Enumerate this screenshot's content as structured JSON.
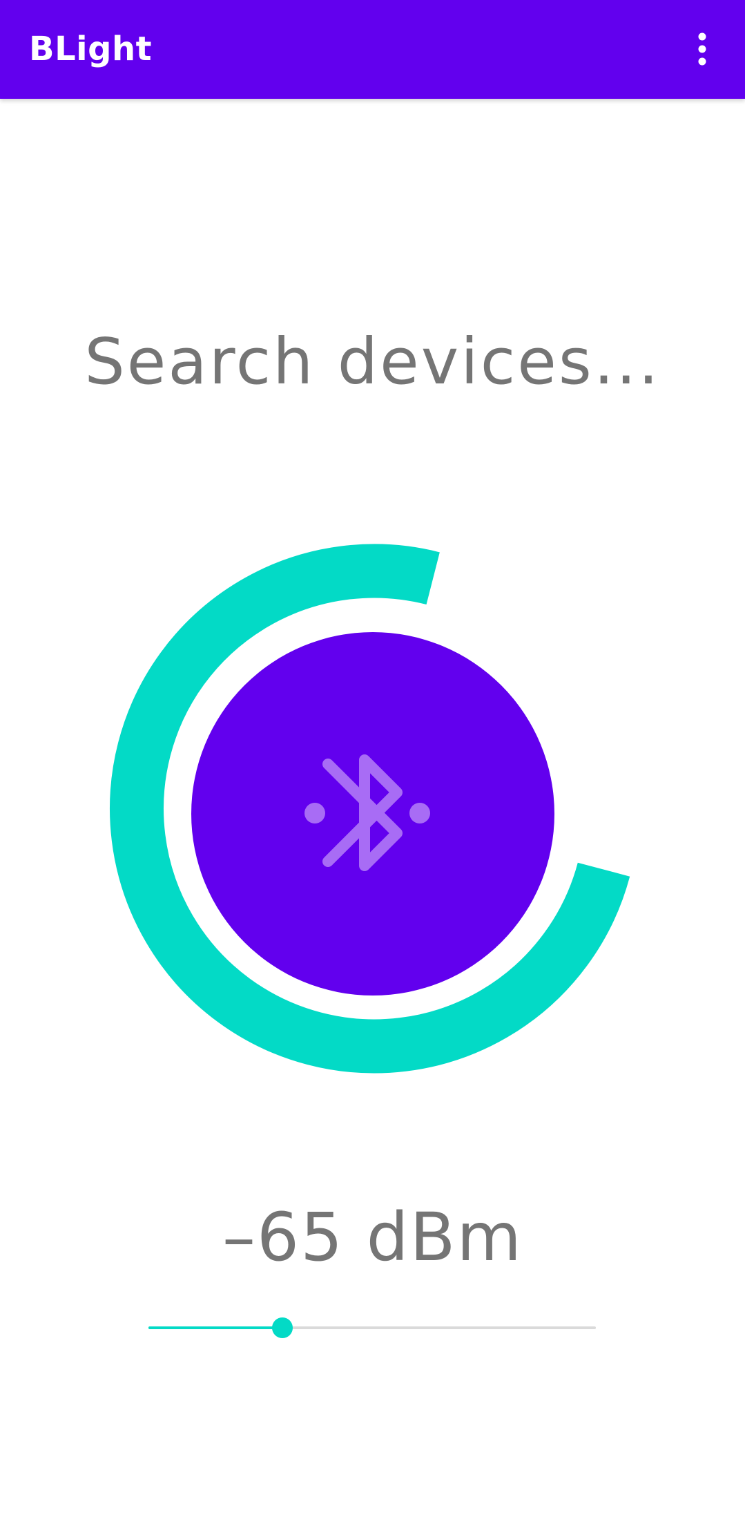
{
  "app_bar": {
    "title": "BLight",
    "menu_icon": "more-vert-icon",
    "color": "#6200ee"
  },
  "main": {
    "status_text": "Search devices...",
    "scan_button": {
      "icon": "bluetooth-searching-icon",
      "color": "#6200ee",
      "icon_color": "#a86cf5"
    },
    "progress_ring": {
      "color": "#03dac6"
    },
    "rssi": {
      "value_text": "–65 dBm",
      "slider_fraction": 0.3,
      "active_color": "#03dac6",
      "inactive_color": "#dadada"
    }
  }
}
